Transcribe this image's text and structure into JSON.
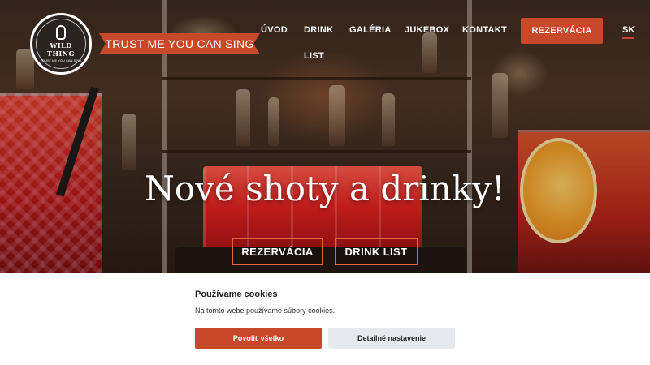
{
  "brand": {
    "logo_name": "WILD THING",
    "logo_sub": "TRUST ME YOU CAN SING",
    "tagline": "TRUST ME YOU CAN SING"
  },
  "nav": {
    "items": [
      "ÚVOD",
      "DRINK",
      "GALÉRIA",
      "JUKEBOX",
      "KONTAKT"
    ],
    "items_second_line": "LIST",
    "reserve_label": "REZERVÁCIA",
    "language": "SK"
  },
  "hero": {
    "headline": "Nové shoty a drinky!",
    "reserve_button": "REZERVÁCIA",
    "drinklist_button": "DRINK LIST"
  },
  "cookie": {
    "title": "Používame cookies",
    "text": "Na tomto webe používame súbory cookies.",
    "accept_label": "Povoliť všetko",
    "settings_label": "Detailné nastavenie"
  },
  "colors": {
    "accent": "#c8482a",
    "cookie_secondary_bg": "#e6e9ee"
  }
}
